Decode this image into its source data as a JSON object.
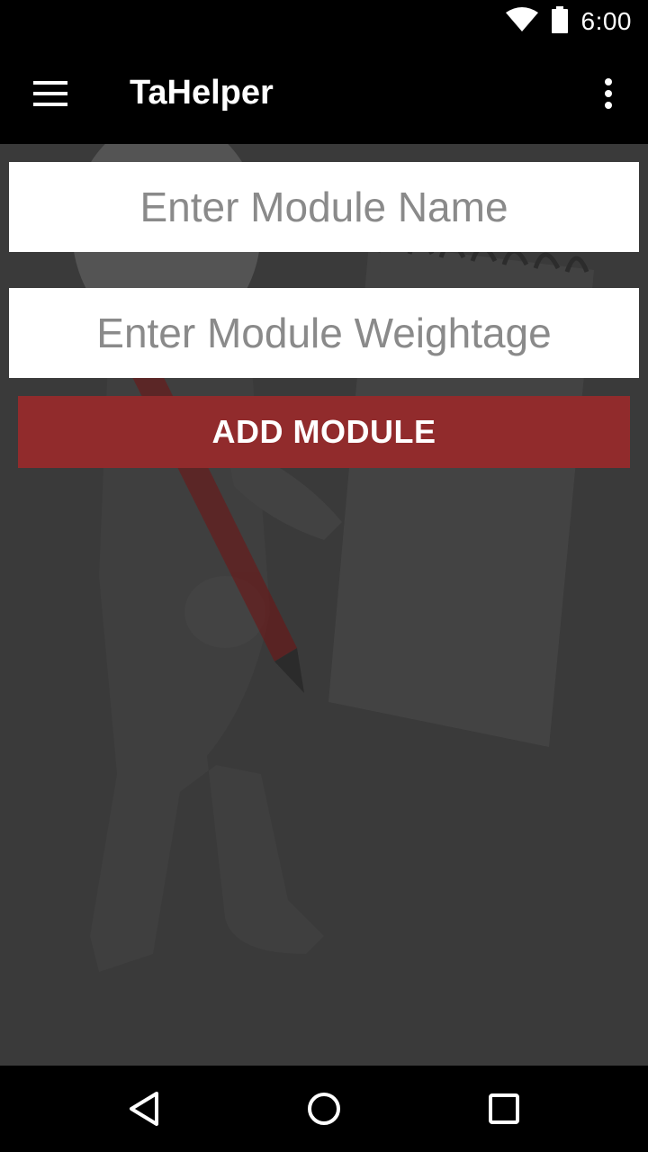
{
  "status_bar": {
    "time": "6:00",
    "icons": [
      "wifi-icon",
      "battery-icon"
    ]
  },
  "app_bar": {
    "title": "TaHelper",
    "left_icon": "hamburger-menu-icon",
    "right_icon": "overflow-menu-icon"
  },
  "form": {
    "module_name_placeholder": "Enter Module Name",
    "module_name_value": "",
    "module_weightage_placeholder": "Enter Module Weightage",
    "module_weightage_value": "",
    "add_button_label": "ADD MODULE"
  },
  "nav_bar": {
    "icons": [
      "back-icon",
      "home-icon",
      "recents-icon"
    ]
  },
  "colors": {
    "app_bar": "#000000",
    "background": "#383838",
    "button": "#912b2c",
    "field": "#ffffff",
    "placeholder": "#8a8a8a"
  }
}
